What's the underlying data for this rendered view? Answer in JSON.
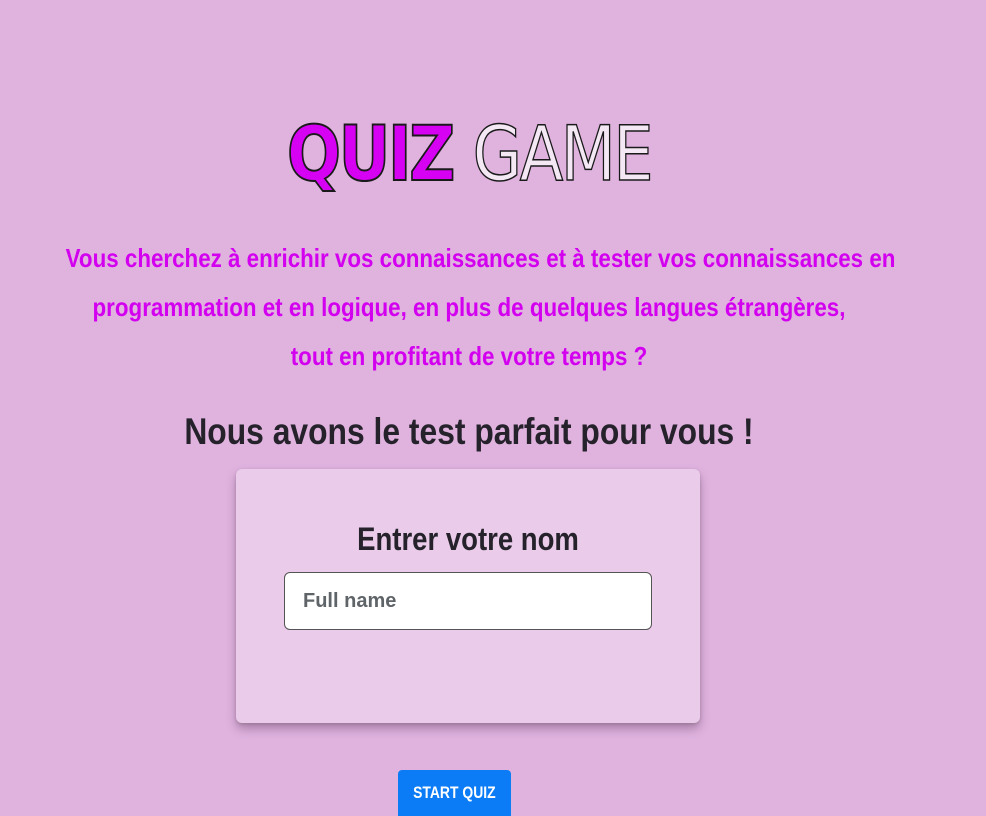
{
  "title": {
    "part1": "QUIZ",
    "part2": "GAME"
  },
  "intro": {
    "line1": "Vous cherchez à enrichir vos connaissances et à tester vos connaissances en",
    "line2": "programmation et en logique, en plus de quelques langues étrangères,",
    "line3": "tout en profitant de votre temps ?"
  },
  "headline": "Nous avons le test parfait pour vous !",
  "form": {
    "title": "Entrer votre nom",
    "name_placeholder": "Full name",
    "name_value": ""
  },
  "start_button_label": "START QUIZ",
  "colors": {
    "background": "#e0b3df",
    "accent_magenta": "#d300ef",
    "card_background": "#eacbe9",
    "button_blue": "#0b7cf6",
    "text_dark": "#25222b"
  }
}
